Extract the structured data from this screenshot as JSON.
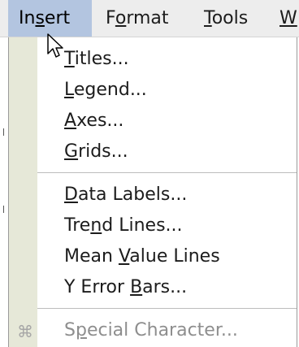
{
  "menubar": {
    "items": [
      {
        "pre": "In",
        "key": "s",
        "post": "ert"
      },
      {
        "pre": "F",
        "key": "o",
        "post": "rmat"
      },
      {
        "pre": "",
        "key": "T",
        "post": "ools"
      },
      {
        "pre": "",
        "key": "W",
        "post": ""
      }
    ]
  },
  "menu": {
    "items": [
      {
        "pre": "",
        "key": "T",
        "post": "itles..."
      },
      {
        "pre": "",
        "key": "L",
        "post": "egend..."
      },
      {
        "pre": "",
        "key": "A",
        "post": "xes..."
      },
      {
        "pre": "",
        "key": "G",
        "post": "rids..."
      },
      {
        "pre": "",
        "key": "D",
        "post": "ata Labels..."
      },
      {
        "pre": "Tre",
        "key": "n",
        "post": "d Lines..."
      },
      {
        "pre": "Mean ",
        "key": "V",
        "post": "alue Lines"
      },
      {
        "pre": "Y Error ",
        "key": "B",
        "post": "ars..."
      },
      {
        "pre": "S",
        "key": "p",
        "post": "ecial Character...",
        "disabled": true
      }
    ],
    "special_icon": "command-key-icon",
    "special_glyph": "⌘"
  },
  "colors": {
    "active_menu": "#b3c5e0",
    "gutter": "#e6e8d8",
    "disabled_text": "#8e8e8e"
  }
}
